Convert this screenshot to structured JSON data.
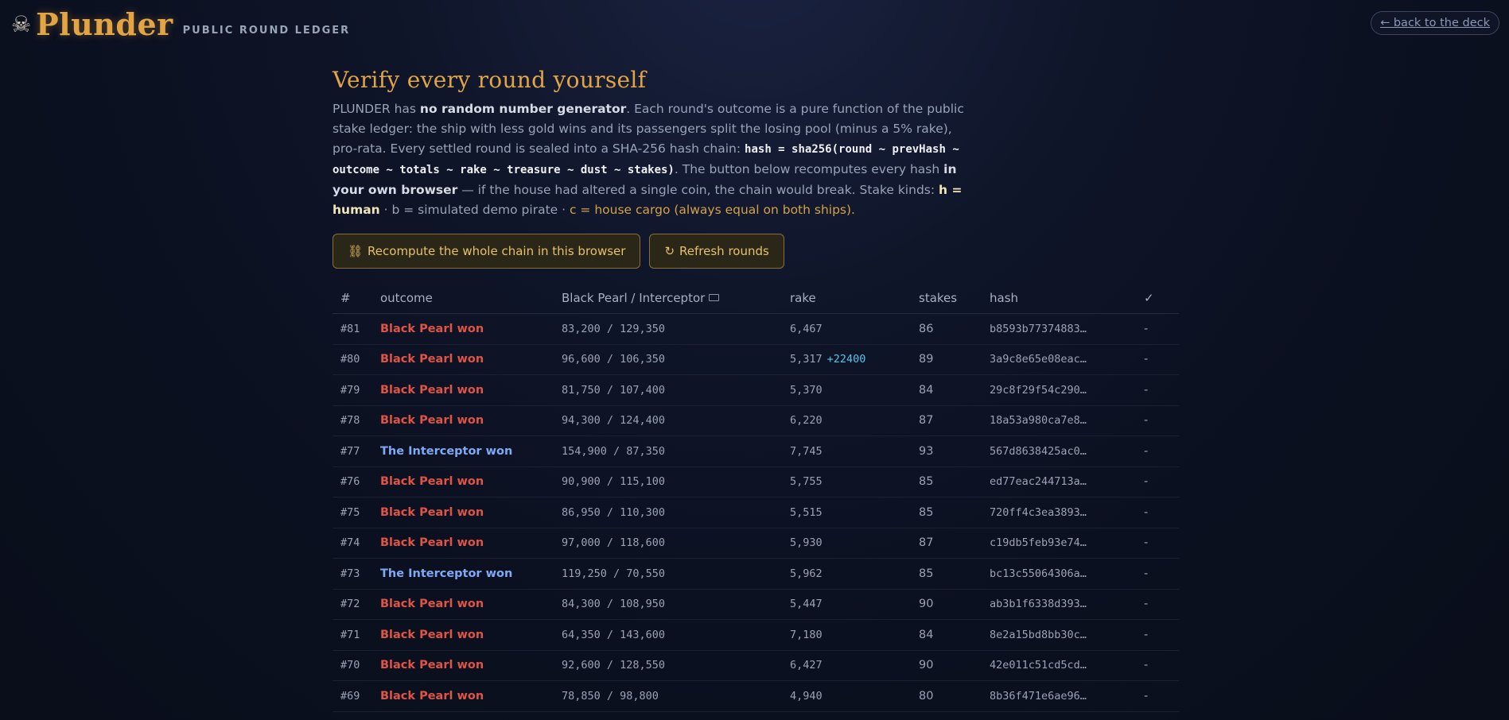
{
  "header": {
    "icon": "☠",
    "title": "Plunder",
    "subtitle": "PUBLIC ROUND LEDGER",
    "back_label": "← back to the deck"
  },
  "intro": {
    "heading": "Verify every round yourself",
    "p1": "PLUNDER has ",
    "p1_bold": "no random number generator",
    "p2": ". Each round's outcome is a pure function of the public stake ledger: the ship with less gold wins and its passengers split the losing pool (minus a 5% rake), pro-rata. Every settled round is sealed into a SHA-256 hash chain: ",
    "formula": "hash = sha256(round ~ prevHash ~ outcome ~ totals ~ rake ~ treasure ~ dust ~ stakes)",
    "p3": ". The button below recomputes every hash ",
    "p3_bold": "in your own browser",
    "p4": " — if the house had altered a single coin, the chain would break. Stake kinds: ",
    "kind_h": "h = human",
    "kind_b": " · b = simulated demo pirate · ",
    "kind_c": "c = house cargo (always equal on both ships).",
    "colors": {
      "gold": "#e3a543",
      "pearl": "#e05444",
      "interceptor": "#7eaaf5"
    }
  },
  "buttons": {
    "recompute_icon": "⛓",
    "recompute_label": "Recompute the whole chain in this browser",
    "refresh_icon": "↻",
    "refresh_label": "Refresh rounds"
  },
  "table": {
    "headers": {
      "num": "#",
      "outcome": "outcome",
      "totals": "Black Pearl / Interceptor",
      "rake": "rake",
      "stakes": "stakes",
      "hash": "hash",
      "check": "✓"
    },
    "rows": [
      {
        "num": "#81",
        "outcome": "Black Pearl won",
        "winner": "pearl",
        "totals": "83,200 / 129,350",
        "rake": "6,467",
        "bonus": "",
        "stakes": "86",
        "hash": "b8593b77374883…",
        "check": "-"
      },
      {
        "num": "#80",
        "outcome": "Black Pearl won",
        "winner": "pearl",
        "totals": "96,600 / 106,350",
        "rake": "5,317",
        "bonus": "+22400",
        "stakes": "89",
        "hash": "3a9c8e65e08eac…",
        "check": "-"
      },
      {
        "num": "#79",
        "outcome": "Black Pearl won",
        "winner": "pearl",
        "totals": "81,750 / 107,400",
        "rake": "5,370",
        "bonus": "",
        "stakes": "84",
        "hash": "29c8f29f54c290…",
        "check": "-"
      },
      {
        "num": "#78",
        "outcome": "Black Pearl won",
        "winner": "pearl",
        "totals": "94,300 / 124,400",
        "rake": "6,220",
        "bonus": "",
        "stakes": "87",
        "hash": "18a53a980ca7e8…",
        "check": "-"
      },
      {
        "num": "#77",
        "outcome": "The Interceptor won",
        "winner": "interceptor",
        "totals": "154,900 / 87,350",
        "rake": "7,745",
        "bonus": "",
        "stakes": "93",
        "hash": "567d8638425ac0…",
        "check": "-"
      },
      {
        "num": "#76",
        "outcome": "Black Pearl won",
        "winner": "pearl",
        "totals": "90,900 / 115,100",
        "rake": "5,755",
        "bonus": "",
        "stakes": "85",
        "hash": "ed77eac244713a…",
        "check": "-"
      },
      {
        "num": "#75",
        "outcome": "Black Pearl won",
        "winner": "pearl",
        "totals": "86,950 / 110,300",
        "rake": "5,515",
        "bonus": "",
        "stakes": "85",
        "hash": "720ff4c3ea3893…",
        "check": "-"
      },
      {
        "num": "#74",
        "outcome": "Black Pearl won",
        "winner": "pearl",
        "totals": "97,000 / 118,600",
        "rake": "5,930",
        "bonus": "",
        "stakes": "87",
        "hash": "c19db5feb93e74…",
        "check": "-"
      },
      {
        "num": "#73",
        "outcome": "The Interceptor won",
        "winner": "interceptor",
        "totals": "119,250 / 70,550",
        "rake": "5,962",
        "bonus": "",
        "stakes": "85",
        "hash": "bc13c55064306a…",
        "check": "-"
      },
      {
        "num": "#72",
        "outcome": "Black Pearl won",
        "winner": "pearl",
        "totals": "84,300 / 108,950",
        "rake": "5,447",
        "bonus": "",
        "stakes": "90",
        "hash": "ab3b1f6338d393…",
        "check": "-"
      },
      {
        "num": "#71",
        "outcome": "Black Pearl won",
        "winner": "pearl",
        "totals": "64,350 / 143,600",
        "rake": "7,180",
        "bonus": "",
        "stakes": "84",
        "hash": "8e2a15bd8bb30c…",
        "check": "-"
      },
      {
        "num": "#70",
        "outcome": "Black Pearl won",
        "winner": "pearl",
        "totals": "92,600 / 128,550",
        "rake": "6,427",
        "bonus": "",
        "stakes": "90",
        "hash": "42e011c51cd5cd…",
        "check": "-"
      },
      {
        "num": "#69",
        "outcome": "Black Pearl won",
        "winner": "pearl",
        "totals": "78,850 / 98,800",
        "rake": "4,940",
        "bonus": "",
        "stakes": "80",
        "hash": "8b36f471e6ae96…",
        "check": "-"
      }
    ]
  }
}
